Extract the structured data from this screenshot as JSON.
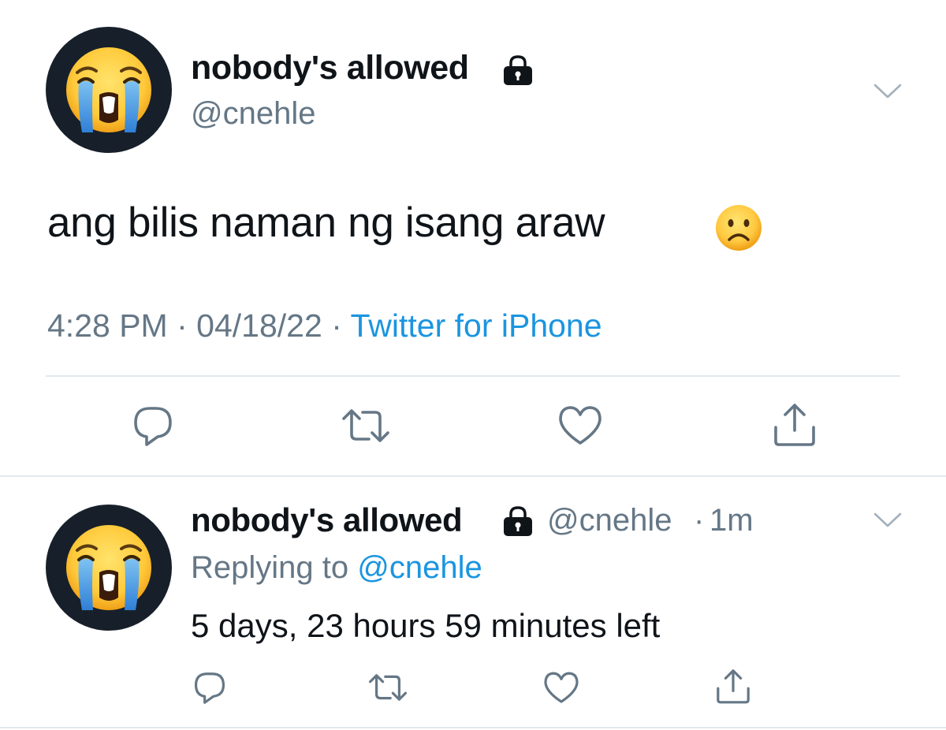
{
  "main_tweet": {
    "display_name": "nobody's allowed",
    "handle": "@cnehle",
    "text": "ang bilis naman ng isang araw",
    "time": "4:28 PM",
    "dot1": "·",
    "date": "04/18/22",
    "dot2": "·",
    "source": "Twitter for iPhone",
    "avatar_icon": "loudly-crying-face-emoji",
    "text_emoji": "frowning-face-emoji",
    "actions": [
      "reply-icon",
      "retweet-icon",
      "like-icon",
      "share-icon"
    ]
  },
  "reply_tweet": {
    "display_name": "nobody's allowed",
    "handle": "@cnehle",
    "separator": "·",
    "time_ago": "1m",
    "replying_prefix": "Replying to",
    "replying_to": "@cnehle",
    "text": "5 days, 23 hours 59 minutes left",
    "avatar_icon": "loudly-crying-face-emoji",
    "actions": [
      "reply-icon",
      "retweet-icon",
      "like-icon",
      "share-icon"
    ]
  },
  "colors": {
    "text": "#0f1419",
    "secondary": "#657786",
    "link": "#1b95e0",
    "divider": "#e1e8ed",
    "icon": "#657786"
  }
}
